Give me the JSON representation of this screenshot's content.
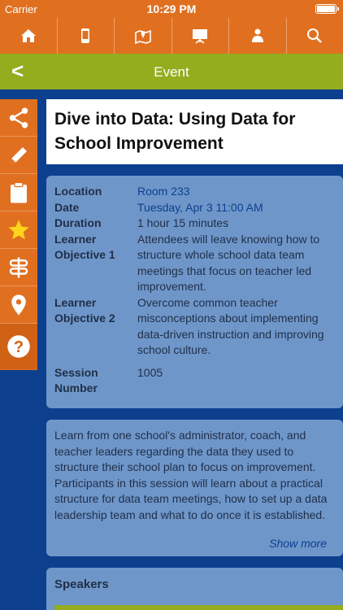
{
  "status": {
    "carrier": "Carrier",
    "time": "10:29 PM"
  },
  "toolbar": {
    "items": [
      {
        "icon": "home-icon"
      },
      {
        "icon": "phone-icon"
      },
      {
        "icon": "map-icon"
      },
      {
        "icon": "presentation-icon"
      },
      {
        "icon": "person-icon"
      },
      {
        "icon": "search-icon"
      }
    ]
  },
  "header": {
    "back_label": "<",
    "title": "Event"
  },
  "sidebar": {
    "items": [
      {
        "icon": "share-icon"
      },
      {
        "icon": "pencil-icon"
      },
      {
        "icon": "clipboard-icon"
      },
      {
        "icon": "star-icon"
      },
      {
        "icon": "signpost-icon"
      },
      {
        "icon": "location-pin-icon"
      },
      {
        "icon": "help-icon"
      }
    ]
  },
  "event": {
    "title": "Dive into Data: Using Data for School Improvement",
    "details": {
      "location_label": "Location",
      "location_value": "Room 233",
      "date_label": "Date",
      "date_value": "Tuesday, Apr 3 11:00 AM",
      "duration_label": "Duration",
      "duration_value": "1 hour 15 minutes",
      "lo1_label": "Learner Objective 1",
      "lo1_value": "Attendees will leave knowing how to structure whole school data team meetings that focus on teacher led improvement.",
      "lo2_label": "Learner Objective 2",
      "lo2_value": "Overcome common teacher misconceptions about implementing data-driven instruction and improving school culture.",
      "session_label": "Session Number",
      "session_value": "1005"
    },
    "description": "Learn from one school's administrator, coach, and teacher leaders regarding the data they used to structure their school plan to focus on improvement. Participants in this session will learn about a practical structure for data team meetings, how to set up a data leadership team and what to do once it is established.",
    "show_more": "Show more",
    "speakers_label": "Speakers"
  },
  "colors": {
    "orange": "#e07020",
    "green": "#93ad1f",
    "navy": "#0d3f8f",
    "card": "#6f96c9"
  }
}
